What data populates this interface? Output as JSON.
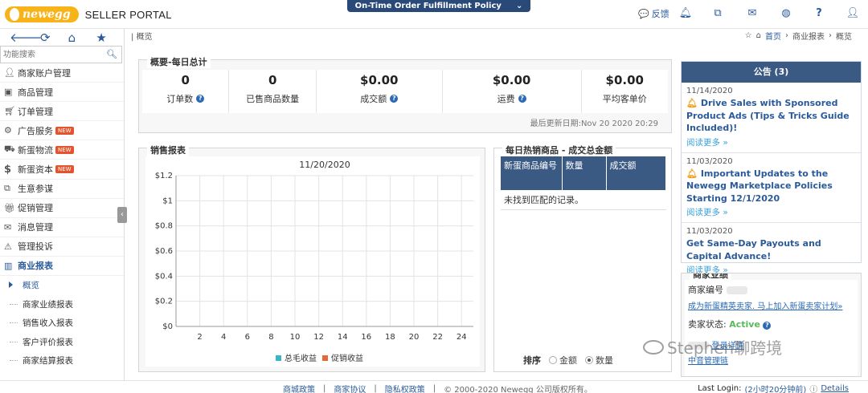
{
  "header": {
    "logo_text": "newegg",
    "portal_text": "SELLER PORTAL",
    "policy_label": "On-Time Order Fulfillment Policy",
    "feedback_label": "反馈",
    "icons": [
      "comment-icon",
      "bell-icon",
      "sitemap-icon",
      "envelope-icon",
      "globe-icon",
      "help-icon",
      "user-icon"
    ]
  },
  "sidebar": {
    "search_placeholder": "功能搜索",
    "new_badge": "NEW",
    "items": [
      {
        "label": "商家账户管理",
        "icon": "user-icon"
      },
      {
        "label": "商品管理",
        "icon": "box-icon"
      },
      {
        "label": "订单管理",
        "icon": "cart-icon"
      },
      {
        "label": "广告服务",
        "icon": "gears-icon",
        "new": true
      },
      {
        "label": "新蛋物流",
        "icon": "truck-icon",
        "new": true
      },
      {
        "label": "新蛋资本",
        "icon": "dollar-icon",
        "new": true
      },
      {
        "label": "生意参谋",
        "icon": "sitemap-icon"
      },
      {
        "label": "促销管理",
        "icon": "gift-icon"
      },
      {
        "label": "消息管理",
        "icon": "envelope-icon"
      },
      {
        "label": "管理投诉",
        "icon": "warning-icon"
      },
      {
        "label": "商业报表",
        "icon": "bar-chart-icon",
        "active": true
      }
    ],
    "subitems": [
      "概览",
      "商家业绩报表",
      "销售收入报表",
      "客户评价报表",
      "商家结算报表"
    ]
  },
  "breadcrumb": {
    "current": "概览",
    "home": "首页",
    "section": "商业报表",
    "page": "概览"
  },
  "summary": {
    "title": "概要-每日总计",
    "cells": [
      {
        "value": "0",
        "label": "订单数",
        "help": true
      },
      {
        "value": "0",
        "label": "已售商品数量",
        "help": false
      },
      {
        "value": "$0.00",
        "label": "成交额",
        "help": true
      },
      {
        "value": "$0.00",
        "label": "运费",
        "help": true
      },
      {
        "value": "$0.00",
        "label": "平均客单价",
        "help": false
      }
    ],
    "updated": "最后更新日期:Nov 20 2020 20:29"
  },
  "sales_report": {
    "title": "销售报表"
  },
  "chart_data": {
    "type": "bar",
    "title": "11/20/2020",
    "x_ticks": [
      2,
      4,
      6,
      8,
      10,
      12,
      14,
      16,
      18,
      20,
      22,
      24
    ],
    "y_ticks": [
      "$0",
      "$0.2",
      "$0.4",
      "$0.6",
      "$0.8",
      "$1",
      "$1.2"
    ],
    "ylim": [
      0,
      1.2
    ],
    "xlim": [
      0,
      25
    ],
    "series": [
      {
        "name": "总毛收益",
        "color": "#3ab5c6",
        "values": []
      },
      {
        "name": "促销收益",
        "color": "#e06a3a",
        "values": []
      }
    ],
    "grid": true,
    "legend": "bottom"
  },
  "hot_items": {
    "title": "每日热销商品 - 成交总金额",
    "columns": [
      "新蛋商品编号",
      "数量",
      "成交额"
    ],
    "empty_text": "未找到匹配的记录。",
    "sort_label": "排序",
    "sort_options": [
      {
        "label": "金额",
        "checked": false
      },
      {
        "label": "数量",
        "checked": true
      }
    ]
  },
  "announcements": {
    "title": "公告 (3)",
    "items": [
      {
        "date": "11/14/2020",
        "title": "Drive Sales with Sponsored Product Ads (Tips & Tricks Guide Included)!",
        "bell": true,
        "more": "阅读更多 »"
      },
      {
        "date": "11/03/2020",
        "title": "Important Updates to the Newegg Marketplace Policies Starting 12/1/2020",
        "bell": true,
        "more": "阅读更多 »"
      },
      {
        "date": "11/03/2020",
        "title": "Get Same-Day Payouts and Capital Advance!",
        "bell": false,
        "more": "阅读更多 »"
      }
    ]
  },
  "merchant": {
    "title": "商家业绩",
    "id_label": "商家编号",
    "elite_link": "成为新蛋精英卖家. 马上加入新蛋卖家计划»",
    "status_label": "卖家状态:",
    "status_value": "Active",
    "link1": "登录详情",
    "link2": "中音管理链"
  },
  "footer": {
    "links": [
      "商城政策",
      "商家协议",
      "隐私权政策"
    ],
    "copyright": "© 2000-2020 Newegg 公司版权所有。",
    "last_login_label": "Last Login:",
    "last_login_value": "(2小时20分钟前)",
    "details": "Details"
  },
  "watermark": "Stephen聊跨境",
  "colors": {
    "brand_blue": "#294a78",
    "accent_blue": "#2a5a9a",
    "header_table": "#3b5a83",
    "new_badge": "#e2532e"
  }
}
